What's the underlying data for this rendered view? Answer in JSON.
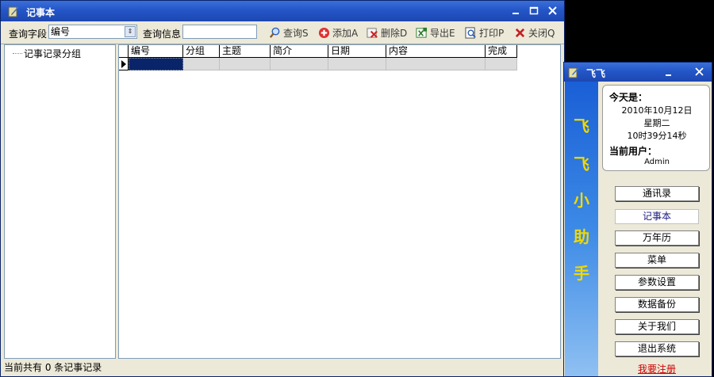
{
  "main_window": {
    "title": "记事本",
    "toolbar": {
      "query_field_label": "查询字段",
      "query_field_value": "编号",
      "query_info_label": "查询信息",
      "query_info_value": "",
      "buttons": {
        "query": "查询S",
        "add": "添加A",
        "delete": "删除D",
        "export": "导出E",
        "print": "打印P",
        "close": "关闭Q"
      }
    },
    "tree": {
      "root": "记事记录分组"
    },
    "grid": {
      "columns": [
        "编号",
        "分组",
        "主题",
        "简介",
        "日期",
        "内容",
        "完成"
      ]
    },
    "status": "当前共有 0 条记事记录"
  },
  "side_window": {
    "title": "飞飞",
    "strip_chars": [
      "飞",
      "飞",
      "小",
      "助",
      "手"
    ],
    "info": {
      "today_label": "今天是：",
      "date": "2010年10月12日",
      "weekday": "星期二",
      "time": "10时39分14秒",
      "user_label": "当前用户：",
      "user": "Admin"
    },
    "menu": [
      "通讯录",
      "记事本",
      "万年历",
      "菜单",
      "参数设置",
      "数据备份",
      "关于我们",
      "退出系统"
    ],
    "register": "我要注册"
  },
  "colors": {
    "titlebar": "#2456c8",
    "window_bg": "#ece9d8",
    "strip_text": "#f0d800",
    "link": "#cc0000"
  }
}
